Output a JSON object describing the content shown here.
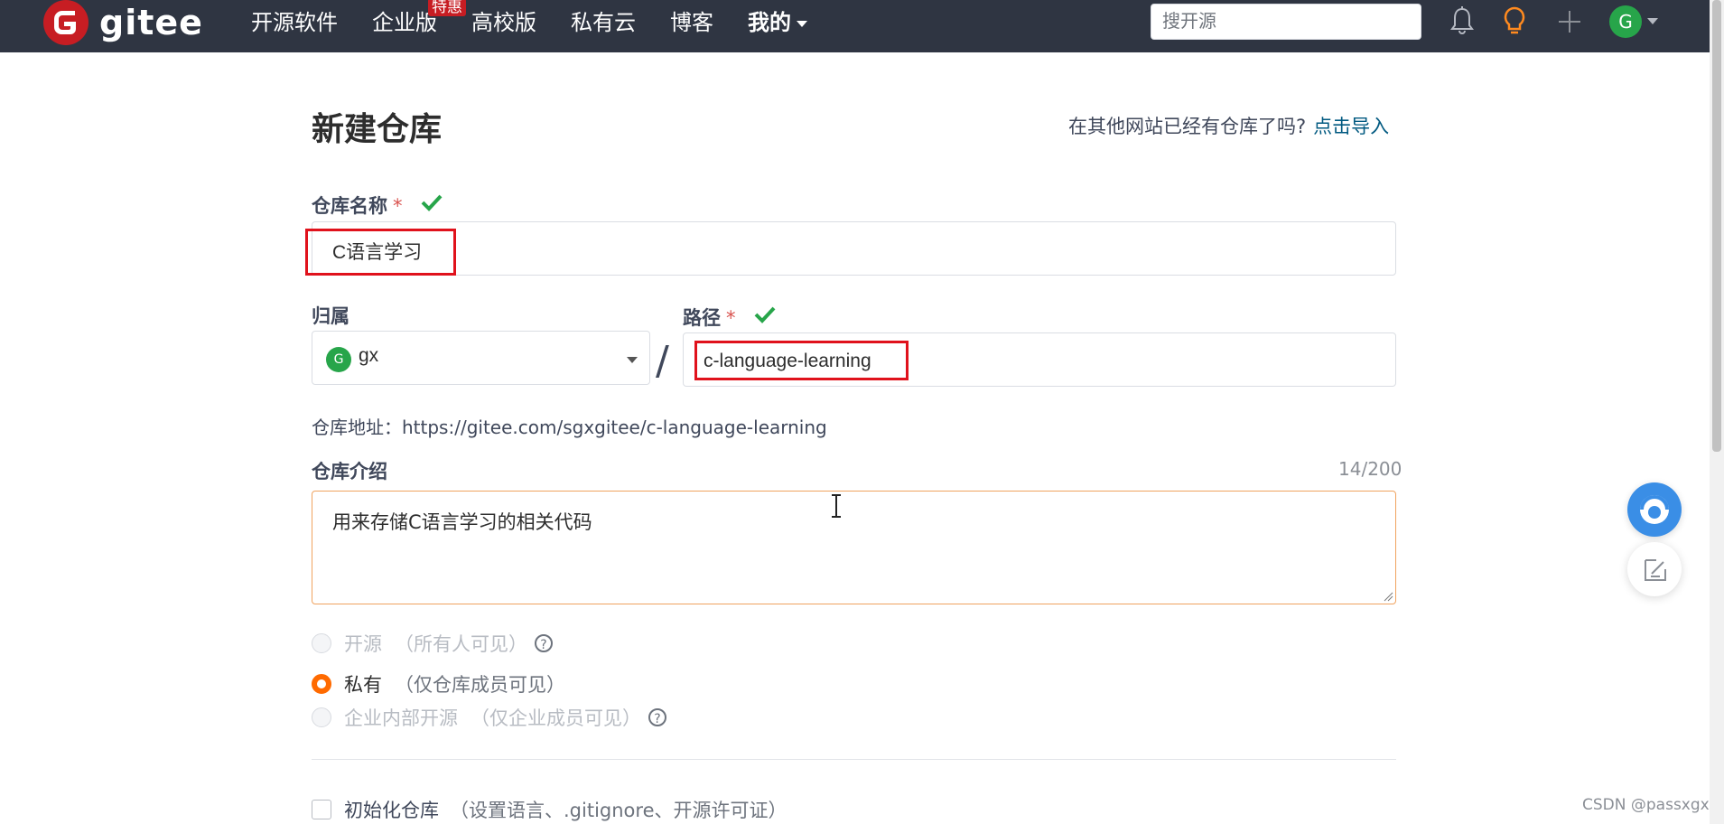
{
  "header": {
    "logo_text": "gitee",
    "nav": [
      {
        "label": "开源软件"
      },
      {
        "label": "企业版",
        "badge": "特惠"
      },
      {
        "label": "高校版"
      },
      {
        "label": "私有云"
      },
      {
        "label": "博客"
      },
      {
        "label": "我的"
      }
    ],
    "search_placeholder": "搜开源",
    "avatar_letter": "G",
    "icons": [
      "bell-icon",
      "lightbulb-icon",
      "plus-icon"
    ]
  },
  "form": {
    "title": "新建仓库",
    "import_prompt": "在其他网站已经有仓库了吗?",
    "import_link": "点击导入",
    "repo_name_label": "仓库名称",
    "required_mark": "*",
    "repo_name_value": "C语言学习",
    "owner_label": "归属",
    "owner_avatar_letter": "G",
    "owner_value": "gx",
    "path_separator": "/",
    "path_label": "路径",
    "path_value": "c-language-learning",
    "address": "仓库地址：https://gitee.com/sgxgitee/c-language-learning",
    "description_label": "仓库介绍",
    "description_counter": "14/200",
    "description_value": "用来存储C语言学习的相关代码",
    "visibility": [
      {
        "label": "开源",
        "hint": "（所有人可见）",
        "selected": false,
        "disabled": true,
        "help": "?"
      },
      {
        "label": "私有",
        "hint": "（仅仓库成员可见）",
        "selected": true,
        "disabled": false
      },
      {
        "label": "企业内部开源",
        "hint": "（仅企业成员可见）",
        "selected": false,
        "disabled": true,
        "help": "?"
      }
    ],
    "init_label": "初始化仓库",
    "init_hint": "（设置语言、.gitignore、开源许可证）"
  },
  "watermark": "CSDN @passxgx",
  "colors": {
    "header_bg": "#2f3542",
    "brand_red": "#c71d23",
    "accent_orange": "#ff6a00",
    "link": "#005980",
    "success_green": "#27a54a",
    "highlight_box": "#e0121c"
  }
}
